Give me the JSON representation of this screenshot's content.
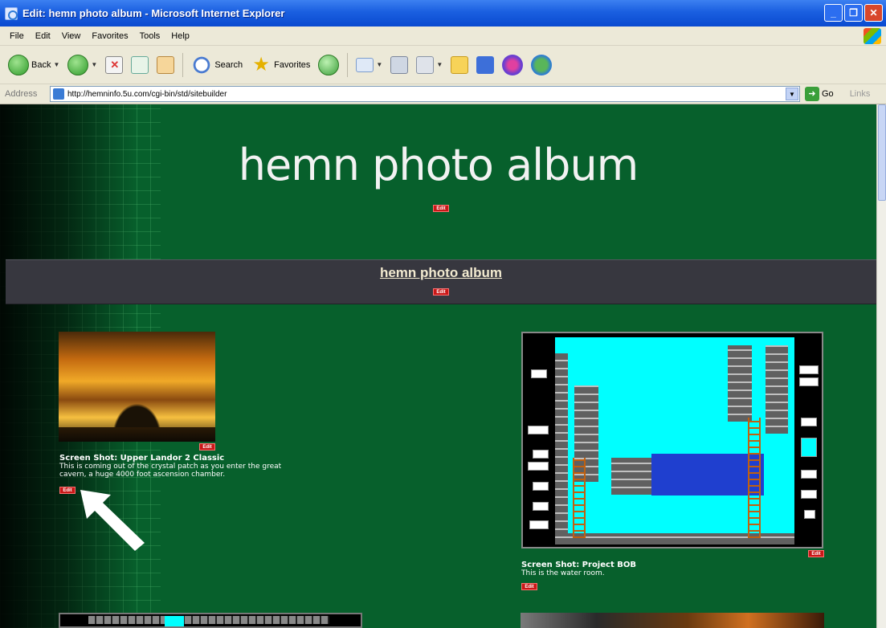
{
  "window": {
    "title": "Edit: hemn photo album - Microsoft Internet Explorer",
    "buttons": [
      "_",
      "❐",
      "✕"
    ]
  },
  "menu": [
    "File",
    "Edit",
    "View",
    "Favorites",
    "Tools",
    "Help"
  ],
  "toolbar": {
    "back_label": "Back",
    "search_label": "Search",
    "favorites_label": "Favorites"
  },
  "address": {
    "label": "Address",
    "url": "http://hemninfo.5u.com/cgi-bin/std/sitebuilder",
    "go_label": "Go",
    "links_label": "Links"
  },
  "page": {
    "site_title": "hemn photo album",
    "nav_link": "hemn photo album",
    "edit_label": "Edit",
    "items": [
      {
        "title": "Screen Shot: Upper Landor 2 Classic",
        "desc_line1": "This is coming out of the crystal patch as you enter the great",
        "desc_line2": "cavern, a huge 4000 foot ascension chamber."
      },
      {
        "title": "Screen Shot: Project BOB",
        "desc_line1": "This is the water room."
      }
    ]
  },
  "colors": {
    "page_bg": "#07602c",
    "nav_band": "#37373f",
    "edit_tag": "#c81818",
    "titlebar": "#1a5fe0"
  }
}
